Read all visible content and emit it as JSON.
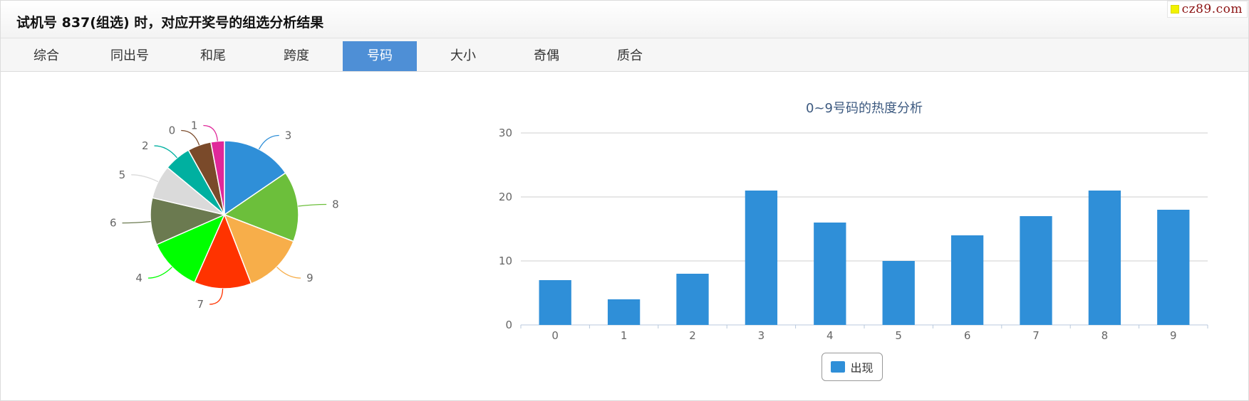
{
  "header": {
    "title": "试机号 837(组选) 时，对应开奖号的组选分析结果"
  },
  "watermark": "cz89.com",
  "tabs": [
    {
      "label": "综合",
      "active": false
    },
    {
      "label": "同出号",
      "active": false
    },
    {
      "label": "和尾",
      "active": false
    },
    {
      "label": "跨度",
      "active": false
    },
    {
      "label": "号码",
      "active": true
    },
    {
      "label": "大小",
      "active": false
    },
    {
      "label": "奇偶",
      "active": false
    },
    {
      "label": "质合",
      "active": false
    }
  ],
  "colors": {
    "tab_active": "#4e8fd6",
    "bar": "#2f8fd8"
  },
  "chart_data": [
    {
      "type": "pie",
      "slices": [
        {
          "label": "3",
          "value": 21,
          "color": "#2f8fd8"
        },
        {
          "label": "8",
          "value": 21,
          "color": "#6cbf3b"
        },
        {
          "label": "9",
          "value": 18,
          "color": "#f7ae4a"
        },
        {
          "label": "7",
          "value": 17,
          "color": "#ff3300"
        },
        {
          "label": "4",
          "value": 16,
          "color": "#00ff00"
        },
        {
          "label": "6",
          "value": 14,
          "color": "#6b7a50"
        },
        {
          "label": "5",
          "value": 10,
          "color": "#dadada"
        },
        {
          "label": "2",
          "value": 8,
          "color": "#00b0a0"
        },
        {
          "label": "0",
          "value": 7,
          "color": "#7a4a2a"
        },
        {
          "label": "1",
          "value": 4,
          "color": "#e0289a"
        }
      ]
    },
    {
      "type": "bar",
      "title": "0~9号码的热度分析",
      "categories": [
        "0",
        "1",
        "2",
        "3",
        "4",
        "5",
        "6",
        "7",
        "8",
        "9"
      ],
      "series": [
        {
          "name": "出现",
          "values": [
            7,
            4,
            8,
            21,
            16,
            10,
            14,
            17,
            21,
            18
          ]
        }
      ],
      "ylim": [
        0,
        30
      ],
      "yticks": [
        "0",
        "10",
        "20",
        "30"
      ],
      "grid": true,
      "legend": "bottom-center"
    }
  ]
}
